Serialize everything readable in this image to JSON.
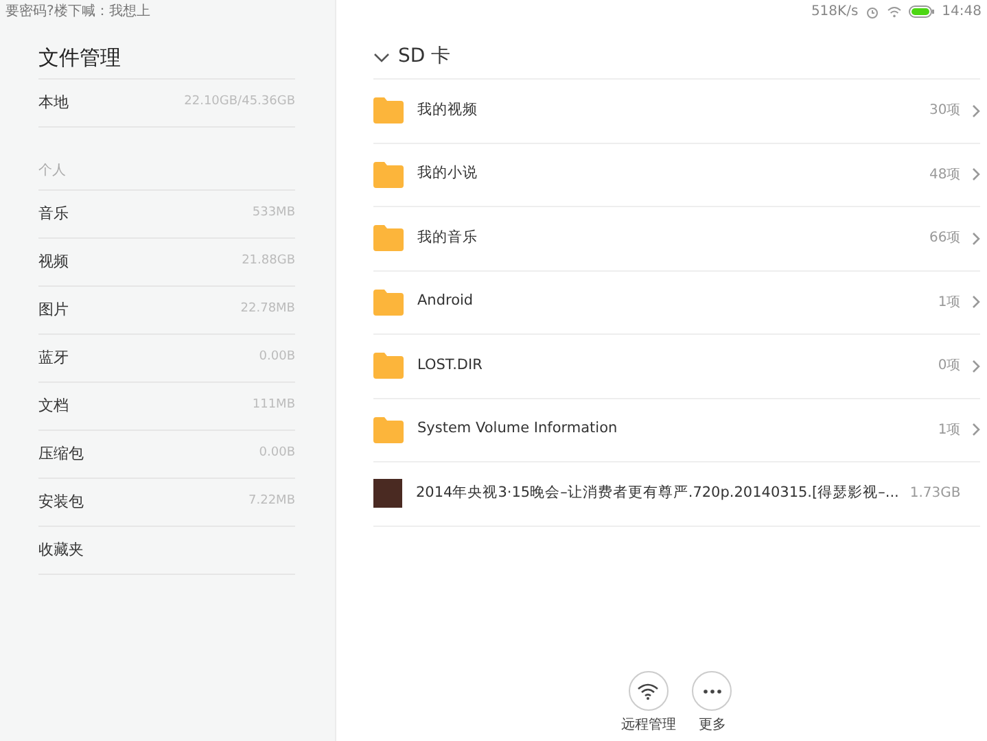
{
  "status_bar": {
    "notification": "要密码?楼下喊：我想上",
    "speed": "518K/s",
    "time": "14:48"
  },
  "sidebar": {
    "title": "文件管理",
    "storage": {
      "label": "本地",
      "value": "22.10GB/45.36GB"
    },
    "section": "个人",
    "items": [
      {
        "label": "音乐",
        "value": "533MB"
      },
      {
        "label": "视频",
        "value": "21.88GB"
      },
      {
        "label": "图片",
        "value": "22.78MB"
      },
      {
        "label": "蓝牙",
        "value": "0.00B"
      },
      {
        "label": "文档",
        "value": "111MB"
      },
      {
        "label": "压缩包",
        "value": "0.00B"
      },
      {
        "label": "安装包",
        "value": "7.22MB"
      },
      {
        "label": "收藏夹"
      }
    ]
  },
  "main": {
    "title": "SD 卡",
    "files": [
      {
        "kind": "folder",
        "name": "我的视频",
        "info": "30项"
      },
      {
        "kind": "folder",
        "name": "我的小说",
        "info": "48项"
      },
      {
        "kind": "folder",
        "name": "我的音乐",
        "info": "66项"
      },
      {
        "kind": "folder",
        "name": "Android",
        "info": "1项"
      },
      {
        "kind": "folder",
        "name": "LOST.DIR",
        "info": "0项"
      },
      {
        "kind": "folder",
        "name": "System Volume Information",
        "info": "1项"
      },
      {
        "kind": "video",
        "name": "2014年央视3·15晚会–让消费者更有尊严.720p.20140315.[得瑟影视–...",
        "info": "1.73GB"
      }
    ]
  },
  "actions": [
    {
      "kind": "wifi",
      "label": "远程管理"
    },
    {
      "kind": "more",
      "label": "更多"
    }
  ]
}
